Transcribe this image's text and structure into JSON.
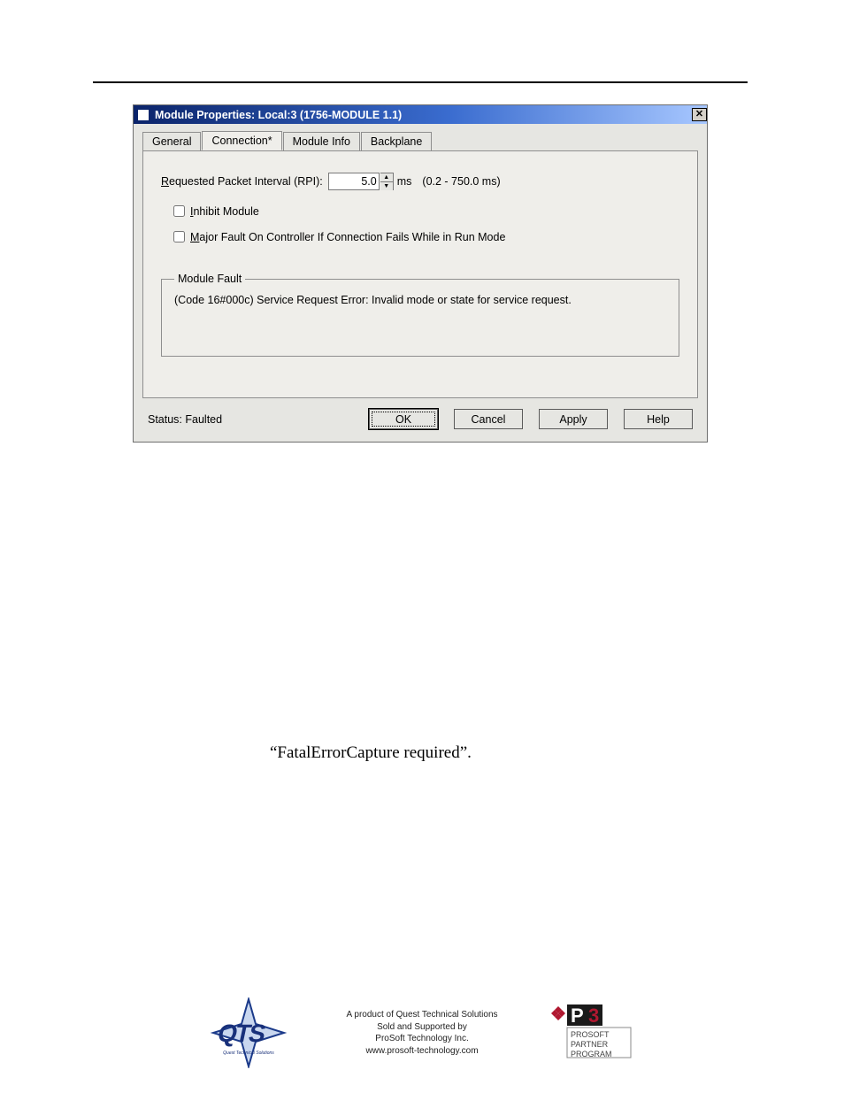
{
  "dialog": {
    "title": "Module Properties: Local:3 (1756-MODULE 1.1)",
    "closeGlyph": "✕",
    "tabs": [
      "General",
      "Connection*",
      "Module Info",
      "Backplane"
    ],
    "activeTab": 1,
    "rpi": {
      "labelPrefix": "R",
      "labelRest": "equested Packet Interval (RPI):",
      "value": "5.0",
      "unit": "ms",
      "range": "(0.2 - 750.0 ms)"
    },
    "inhibit": {
      "prefix": "I",
      "rest": "nhibit Module"
    },
    "majorFault": {
      "prefix": "M",
      "rest": "ajor Fault On Controller If Connection Fails While in Run Mode"
    },
    "moduleFault": {
      "legend": "Module Fault",
      "text": "(Code 16#000c) Service Request Error: Invalid mode or state for service request."
    },
    "statusLabel": "Status:  Faulted",
    "buttons": {
      "ok": "OK",
      "cancel": "Cancel",
      "apply": "Apply",
      "help": "Help"
    }
  },
  "body": {
    "line1Left": "“FatalErrorCapture required”."
  },
  "footer": {
    "line1": "A product of Quest Technical Solutions",
    "line2": "Sold and Supported by",
    "line3": "ProSoft Technology Inc.",
    "line4": "www.prosoft-technology.com",
    "p3_line1": "PROSOFT",
    "p3_line2": "PARTNER",
    "p3_line3": "PROGRAM"
  }
}
